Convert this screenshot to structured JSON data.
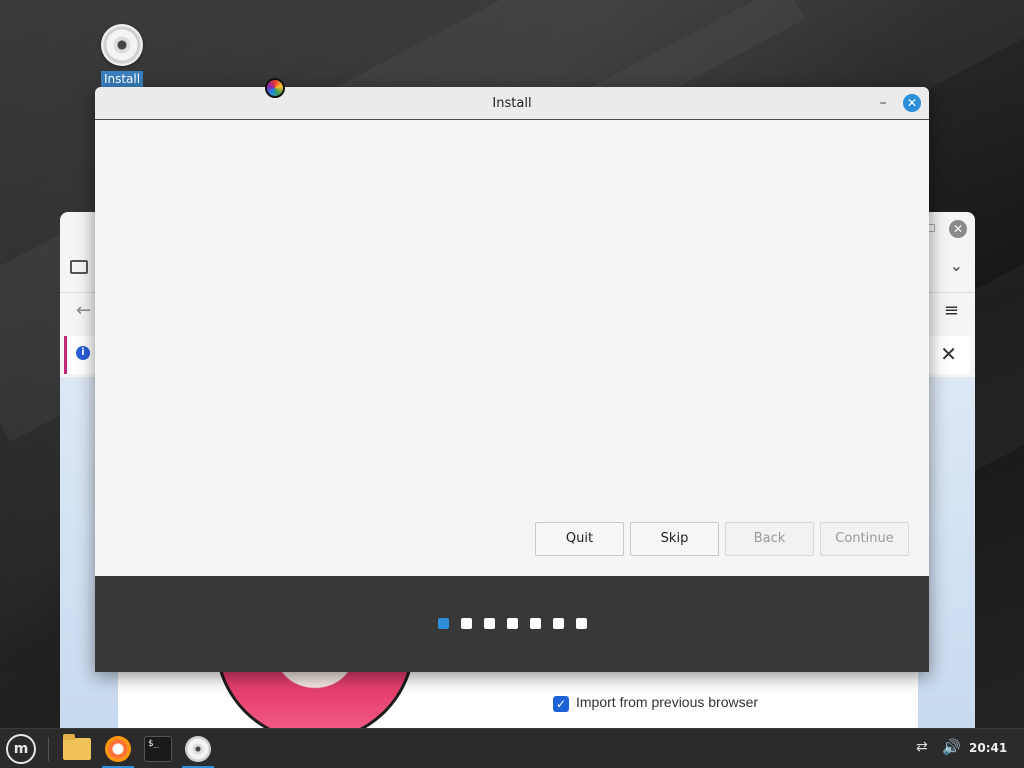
{
  "desktop": {
    "icon_label": "Install"
  },
  "browser": {
    "import_checkbox_label": "Import from previous browser",
    "import_checked": true
  },
  "install_dialog": {
    "title": "Install",
    "buttons": {
      "quit": "Quit",
      "skip": "Skip",
      "back": "Back",
      "continue": "Continue"
    },
    "progress": {
      "steps_total": 7,
      "current_step": 1
    }
  },
  "taskbar": {
    "clock": "20:41",
    "launchers": [
      "folder-icon",
      "firefox-icon",
      "terminal-icon",
      "disc-icon"
    ]
  },
  "colors": {
    "accent": "#2d8fd9",
    "taskbar_bg": "#2b2b2b",
    "dialog_footer": "#383838"
  }
}
